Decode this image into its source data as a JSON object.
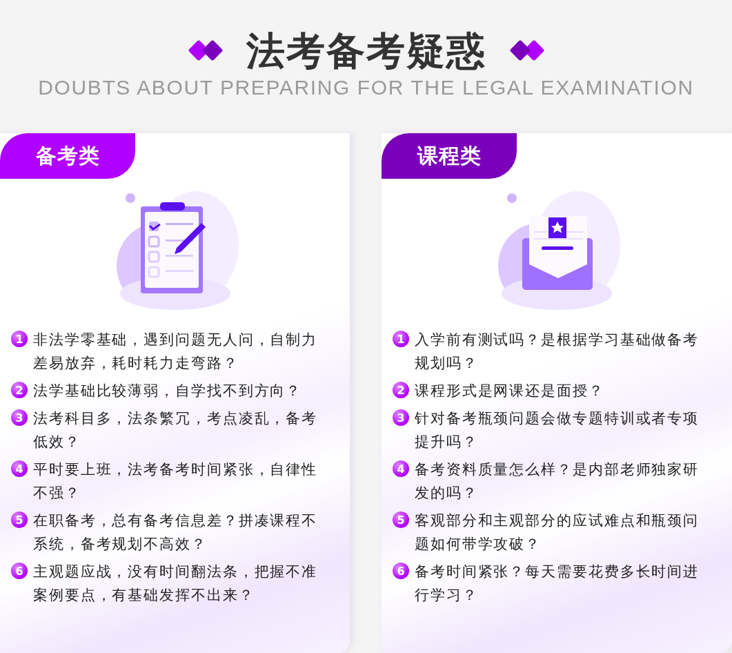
{
  "header": {
    "title": "法考备考疑惑",
    "subtitle": "DOUBTS ABOUT PREPARING FOR THE LEGAL EXAMINATION"
  },
  "cards": [
    {
      "tag": "备考类",
      "color": "#b000ff",
      "kind": "clipboard",
      "items": [
        {
          "number": "1",
          "text": "非法学零基础，遇到问题无人问，自制力差易放弃，耗时耗力走弯路？"
        },
        {
          "number": "2",
          "text": "法学基础比较薄弱，自学找不到方向？"
        },
        {
          "number": "3",
          "text": "法考科目多，法条繁冗，考点凌乱，备考低效？"
        },
        {
          "number": "4",
          "text": "平时要上班，法考备考时间紧张，自律性不强？"
        },
        {
          "number": "5",
          "text": "在职备考，总有备考信息差？拼凑课程不系统，备考规划不高效？"
        },
        {
          "number": "6",
          "text": "主观题应战，没有时间翻法条，把握不准案例要点，有基础发挥不出来？"
        }
      ]
    },
    {
      "tag": "课程类",
      "color": "#7b00bb",
      "kind": "envelope",
      "items": [
        {
          "number": "1",
          "text": "入学前有测试吗？是根据学习基础做备考规划吗？"
        },
        {
          "number": "2",
          "text": "课程形式是网课还是面授？"
        },
        {
          "number": "3",
          "text": "针对备考瓶颈问题会做专题特训或者专项提升吗？"
        },
        {
          "number": "4",
          "text": "备考资料质量怎么样？是内部老师独家研发的吗？"
        },
        {
          "number": "5",
          "text": "客观部分和主观部分的应试难点和瓶颈问题如何带学攻破？"
        },
        {
          "number": "6",
          "text": "备考时间紧张？每天需要花费多长时间进行学习？"
        }
      ]
    }
  ]
}
